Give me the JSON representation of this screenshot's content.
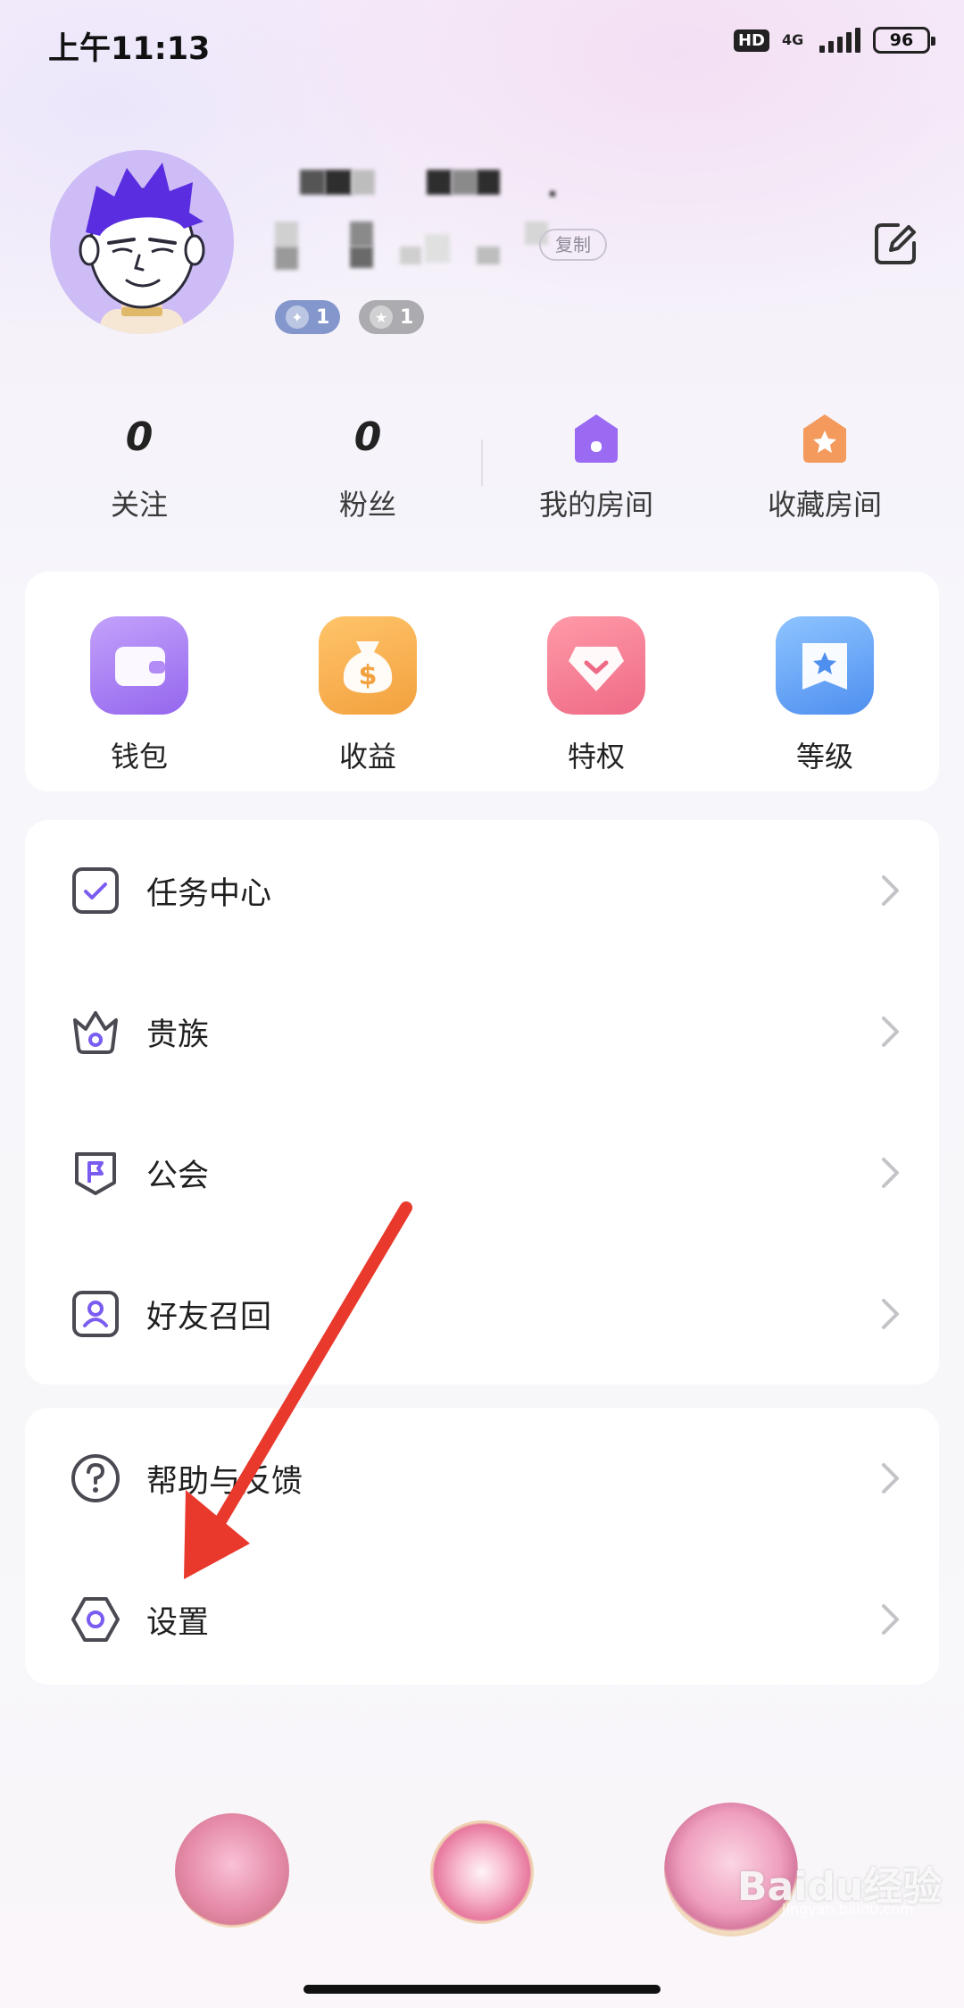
{
  "status_bar": {
    "time": "上午11:13",
    "hd_label": "HD",
    "network_label": "4G",
    "battery_level": "96"
  },
  "profile": {
    "copy_label": "复制",
    "badges": [
      {
        "icon": "sparkle-icon",
        "value": "1",
        "color": "#7f93c9"
      },
      {
        "icon": "star-icon",
        "value": "1",
        "color": "#a9a9ad"
      }
    ]
  },
  "stats": [
    {
      "value": "0",
      "label": "关注"
    },
    {
      "value": "0",
      "label": "粉丝"
    },
    {
      "icon": "room-house-icon",
      "label": "我的房间",
      "color": "#9a6bf2"
    },
    {
      "icon": "favorite-room-icon",
      "label": "收藏房间",
      "color": "#f39a5c"
    }
  ],
  "quick_actions": [
    {
      "icon": "wallet-icon",
      "label": "钱包",
      "color": "#a77ff1"
    },
    {
      "icon": "money-bag-icon",
      "label": "收益",
      "color": "#f5a444"
    },
    {
      "icon": "privilege-icon",
      "label": "特权",
      "color": "#f06f8a"
    },
    {
      "icon": "level-icon",
      "label": "等级",
      "color": "#5a9df0"
    }
  ],
  "menu_group_1": [
    {
      "icon": "task-check-icon",
      "label": "任务中心"
    },
    {
      "icon": "crown-icon",
      "label": "贵族"
    },
    {
      "icon": "guild-flag-icon",
      "label": "公会"
    },
    {
      "icon": "friend-recall-icon",
      "label": "好友召回"
    }
  ],
  "menu_group_2": [
    {
      "icon": "help-question-icon",
      "label": "帮助与反馈"
    },
    {
      "icon": "settings-hexagon-icon",
      "label": "设置"
    }
  ],
  "watermark": {
    "text": "Baidu经验",
    "sub": "jingyan.baidu.com"
  },
  "colors": {
    "accent": "#7b5cf0",
    "arrow": "#e8392c",
    "icon_stroke": "#4a4a52",
    "chevron": "#c4c4c8"
  }
}
